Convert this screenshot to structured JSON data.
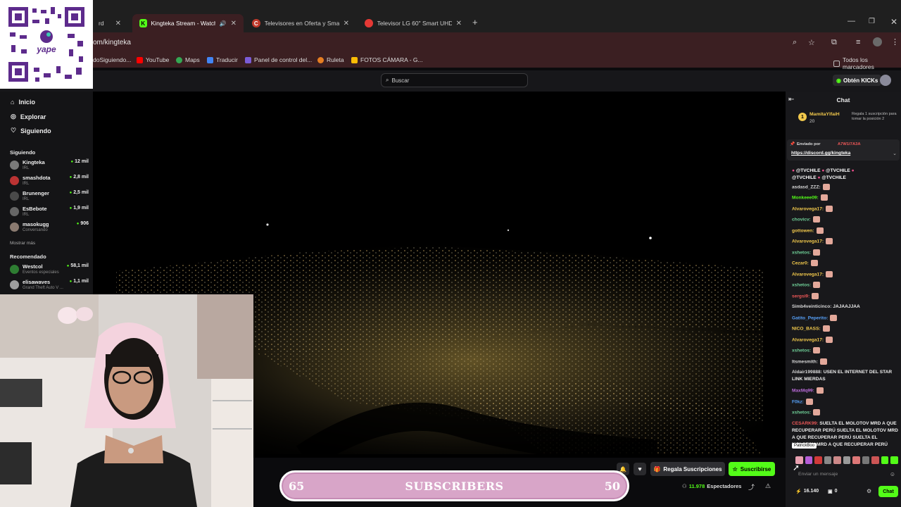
{
  "browser": {
    "tabs": [
      {
        "label": "rd",
        "active": false
      },
      {
        "label": "Kingteka Stream - Watch Li",
        "active": true
      },
      {
        "label": "Televisores en Oferta y Smart T",
        "active": false
      },
      {
        "label": "Televisor LG 60\" Smart UHD 4K",
        "active": false
      }
    ],
    "url": "om/kingteka",
    "bookmarks": [
      "doSiguiendo...",
      "YouTube",
      "Maps",
      "Traducir",
      "Panel de control del...",
      "Ruleta",
      "FOTOS CÁMARA - G..."
    ],
    "all_bookmarks": "Todos los marcadores"
  },
  "qr_label": "yape",
  "topnav": {
    "search_placeholder": "Buscar",
    "kicks_button": "Obtén KICKs"
  },
  "sidebar": {
    "nav": [
      "Inicio",
      "Explorar",
      "Siguiendo"
    ],
    "following_title": "Siguiendo",
    "following": [
      {
        "name": "Kingteka",
        "category": "IRL",
        "viewers": "12 mil"
      },
      {
        "name": "smashdota",
        "category": "IRL",
        "viewers": "2,8 mil"
      },
      {
        "name": "Brunenger",
        "category": "IRL",
        "viewers": "2,5 mil"
      },
      {
        "name": "EsBebote",
        "category": "IRL",
        "viewers": "1,9 mil"
      },
      {
        "name": "masokugg",
        "category": "Conversando",
        "viewers": "906"
      }
    ],
    "show_more": "Mostrar más",
    "recommended_title": "Recomendado",
    "recommended": [
      {
        "name": "Westcol",
        "category": "Eventos especiales",
        "viewers": "58,1 mil"
      },
      {
        "name": "elisawaves",
        "category": "Grand Theft Auto V ...",
        "viewers": "1,1 mil"
      }
    ]
  },
  "chat": {
    "title": "Chat",
    "top_gifter": {
      "name": "MamitaYlfaiH",
      "count": "20",
      "note": "Regala 1 suscripción para tomar la posición 2"
    },
    "pinned": {
      "sent_by": "Enviado por",
      "user": "A7W1I7A3A",
      "link": "https://discord.gg/kingteka"
    },
    "mentions": [
      "@TVCHILE",
      "@TVCHILE",
      "@TVCHILE",
      "@TVCHILE"
    ],
    "messages": [
      {
        "user": "asdasd_ZZZ:",
        "color": "#d7d7d7",
        "text": ""
      },
      {
        "user": "Monkeee09:",
        "color": "#53fc18",
        "text": ""
      },
      {
        "user": "Alvarovega17:",
        "color": "#f2c94c",
        "text": ""
      },
      {
        "user": "chovicv:",
        "color": "#6fcf97",
        "text": ""
      },
      {
        "user": "gottowen:",
        "color": "#f2c94c",
        "text": ""
      },
      {
        "user": "Alvarovega17:",
        "color": "#f2c94c",
        "text": ""
      },
      {
        "user": "xshetos:",
        "color": "#6fcf97",
        "text": ""
      },
      {
        "user": "Cezar0:",
        "color": "#f2c94c",
        "text": ""
      },
      {
        "user": "Alvarovega17:",
        "color": "#f2c94c",
        "text": ""
      },
      {
        "user": "xshetos:",
        "color": "#6fcf97",
        "text": ""
      },
      {
        "user": "sergsi9:",
        "color": "#eb5757",
        "text": ""
      },
      {
        "user": "Simb4veinticinco:",
        "color": "#d7d7d7",
        "text": "JAJAAJJAA"
      },
      {
        "user": "Gatito_Peperito:",
        "color": "#56a0f8",
        "text": ""
      },
      {
        "user": "NICO_BASS:",
        "color": "#f2c94c",
        "text": ""
      },
      {
        "user": "Alvarovega17:",
        "color": "#f2c94c",
        "text": ""
      },
      {
        "user": "xshetos:",
        "color": "#6fcf97",
        "text": ""
      },
      {
        "user": "Itsmesmith:",
        "color": "#d7d7d7",
        "text": ""
      },
      {
        "user": "Aldair199888:",
        "color": "#d7d7d7",
        "text": "USEN EL INTERNET DEL STAR LINK MIERDAS"
      },
      {
        "user": "MaxMq99:",
        "color": "#bb6bd9",
        "text": ""
      },
      {
        "user": "F0kz:",
        "color": "#56a0f8",
        "text": ""
      },
      {
        "user": "xshetos:",
        "color": "#6fcf97",
        "text": ""
      },
      {
        "user": "CESARK99:",
        "color": "#eb5757",
        "text": "SUELTA EL MOLOTOV MRD A QUE RECUPERAR PERÚ SUELTA EL MOLOTOV MRD A QUE RECUPERAR PERÚ SUELTA EL MOLOTOV MRD A QUE RECUPERAR PERÚ"
      }
    ],
    "tooltip": "PatrickBoo",
    "input_placeholder": "Enviar un mensaje",
    "kicks_count": "16.140",
    "gift_count": "0",
    "send_button": "Chat"
  },
  "stream": {
    "gift_button": "Regala Suscripciones",
    "subscribe_button": "Suscribirse",
    "viewers": "11.978",
    "viewers_label": "Espectadores"
  },
  "banner": {
    "left": "65",
    "title": "SUBSCRIBERS",
    "right": "50"
  },
  "colors": {
    "accent": "#53fc18",
    "tab_bg": "#3b1f22"
  }
}
